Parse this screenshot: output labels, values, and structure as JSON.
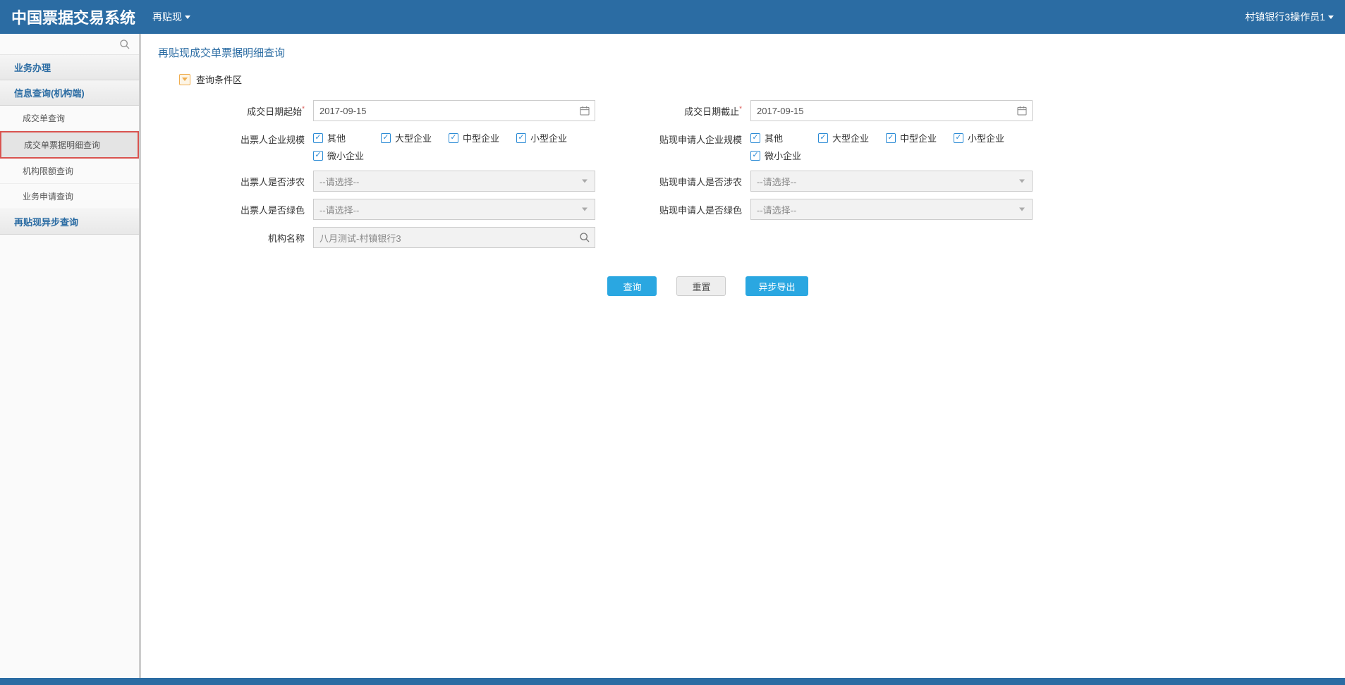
{
  "header": {
    "app_title": "中国票据交易系统",
    "menu_label": "再贴现",
    "user_label": "村镇银行3操作员1"
  },
  "sidebar": {
    "groups": [
      {
        "label": "业务办理",
        "items": []
      },
      {
        "label": "信息查询(机构端)",
        "items": [
          {
            "label": "成交单查询"
          },
          {
            "label": "成交单票据明细查询",
            "selected": true,
            "highlighted": true
          },
          {
            "label": "机构限额查询"
          },
          {
            "label": "业务申请查询"
          }
        ]
      },
      {
        "label": "再贴现异步查询",
        "items": []
      }
    ]
  },
  "page": {
    "title": "再贴现成交单票据明细查询",
    "section_title": "查询条件区"
  },
  "form": {
    "left": {
      "date_start": {
        "label": "成交日期起始",
        "required": true,
        "value": "2017-09-15"
      },
      "scale": {
        "label": "出票人企业规模",
        "options": [
          "其他",
          "大型企业",
          "中型企业",
          "小型企业",
          "微小企业"
        ]
      },
      "agri": {
        "label": "出票人是否涉农",
        "placeholder": "--请选择--"
      },
      "green": {
        "label": "出票人是否绿色",
        "placeholder": "--请选择--"
      },
      "org": {
        "label": "机构名称",
        "value": "八月测试-村镇银行3"
      }
    },
    "right": {
      "date_end": {
        "label": "成交日期截止",
        "required": true,
        "value": "2017-09-15"
      },
      "scale": {
        "label": "贴现申请人企业规模",
        "options": [
          "其他",
          "大型企业",
          "中型企业",
          "小型企业",
          "微小企业"
        ]
      },
      "agri": {
        "label": "贴现申请人是否涉农",
        "placeholder": "--请选择--"
      },
      "green": {
        "label": "贴现申请人是否绿色",
        "placeholder": "--请选择--"
      }
    }
  },
  "buttons": {
    "query": "查询",
    "reset": "重置",
    "export": "异步导出"
  }
}
